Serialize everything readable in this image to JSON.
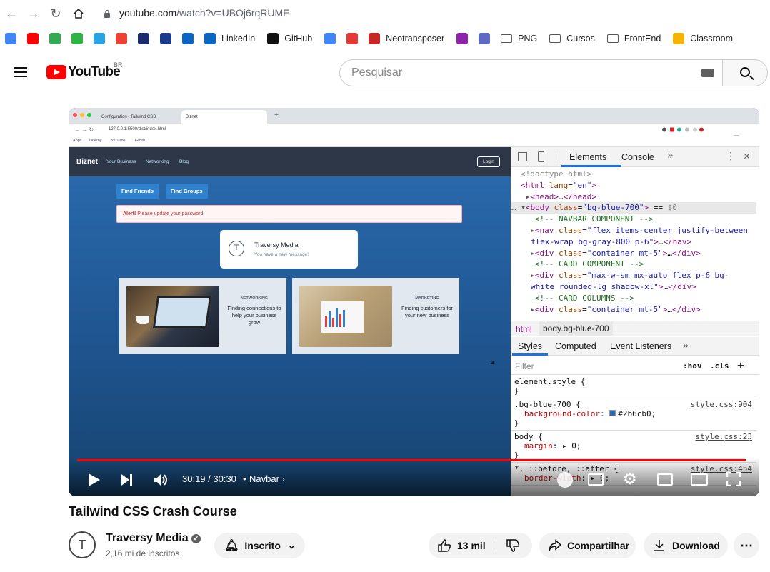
{
  "browser": {
    "address_host": "youtube.com",
    "address_path": "/watch?v=UBOj6rqRUME",
    "bookmarks": [
      {
        "label": "",
        "color": "#4285f4",
        "icon": "google-icon"
      },
      {
        "label": "",
        "color": "#ff0000",
        "icon": "youtube-icon"
      },
      {
        "label": "",
        "color": "#34a853",
        "icon": "drive-icon"
      },
      {
        "label": "",
        "color": "#2fb344",
        "icon": "whatsapp-icon"
      },
      {
        "label": "",
        "color": "#2aa3e0",
        "icon": "telegram-icon"
      },
      {
        "label": "",
        "color": "#ea4335",
        "icon": "gmail-icon"
      },
      {
        "label": "",
        "color": "#1c2b6b",
        "icon": "app-icon"
      },
      {
        "label": "",
        "color": "#1b3a8a",
        "icon": "app-icon-2"
      },
      {
        "label": "",
        "color": "#0a66c2",
        "icon": "outlook-icon"
      },
      {
        "label": "LinkedIn",
        "color": "#0a66c2",
        "icon": "linkedin-icon"
      },
      {
        "label": "GitHub",
        "color": "#111111",
        "icon": "github-icon"
      },
      {
        "label": "",
        "color": "#4285f4",
        "icon": "translate-icon"
      },
      {
        "label": "",
        "color": "#e53935",
        "icon": "download-icon"
      },
      {
        "label": "Neotransposer",
        "color": "#c62828",
        "icon": "re-icon"
      },
      {
        "label": "",
        "color": "#8e24aa",
        "icon": "app-icon-3"
      },
      {
        "label": "",
        "color": "#5c6bc0",
        "icon": "app-icon-4"
      },
      {
        "label": "PNG",
        "color": "#555555",
        "icon": "folder-icon"
      },
      {
        "label": "Cursos",
        "color": "#555555",
        "icon": "folder-icon"
      },
      {
        "label": "FrontEnd",
        "color": "#555555",
        "icon": "folder-icon"
      },
      {
        "label": "Classroom",
        "color": "#f4b400",
        "icon": "classroom-icon"
      }
    ]
  },
  "header": {
    "logo_text": "YouTube",
    "region": "BR",
    "search_placeholder": "Pesquisar"
  },
  "video_frame": {
    "tabs": [
      "Configuration - Tailwind CSS",
      "Biznet"
    ],
    "address": "127.0.0.1:5500/dist/index.html",
    "bookmarks": [
      "Apps",
      "Udemy",
      "YouTube",
      "Gmail"
    ],
    "site": {
      "brand": "Biznet",
      "nav": [
        "Your Business",
        "Networking",
        "Blog"
      ],
      "login": "Login",
      "buttons": [
        "Find Friends",
        "Find Groups"
      ],
      "alert_strong": "Alert!",
      "alert_text": " Please update your password",
      "toast_title": "Traversy Media",
      "toast_text": "You have a new message!",
      "cards": [
        {
          "tag": "NETWORKING",
          "text": "Finding connections to help your business grow"
        },
        {
          "tag": "MARKETING",
          "text": "Finding customers for your new business"
        }
      ]
    },
    "devtools": {
      "tabs": [
        "Elements",
        "Console"
      ],
      "code": [
        {
          "html": "<span style='color:#888'>&lt;!doctype html&gt;</span>"
        },
        {
          "html": "<span style='color:#881280'>&lt;html</span> <span style='color:#994500'>lang</span>=<span style='color:#1a1aa6'>\"en\"</span><span style='color:#881280'>&gt;</span>"
        },
        {
          "html": "&nbsp;<span style='color:#555'>▸</span><span style='color:#881280'>&lt;head&gt;</span>…<span style='color:#881280'>&lt;/head&gt;</span>"
        },
        {
          "html": "<span style='color:#555'>… ▾</span><span style='color:#881280'>&lt;body</span> <span style='color:#994500'>class</span>=<span style='color:#1a1aa6'>\"bg-blue-700\"</span><span style='color:#881280'>&gt;</span> == <span style='color:#888'>$0</span>",
          "sel": true
        },
        {
          "html": "&nbsp;&nbsp;&nbsp;<span style='color:#236e25'>&lt;!-- NAVBAR COMPONENT --&gt;</span>"
        },
        {
          "html": "&nbsp;&nbsp;<span style='color:#555'>▸</span><span style='color:#881280'>&lt;nav</span> <span style='color:#994500'>class</span>=<span style='color:#1a1aa6'>\"flex items-center justify-between</span>"
        },
        {
          "html": "<span style='color:#1a1aa6'>flex-wrap bg-gray-800 p-6\"</span><span style='color:#881280'>&gt;</span>…<span style='color:#881280'>&lt;/nav&gt;</span>"
        },
        {
          "html": "&nbsp;&nbsp;<span style='color:#555'>▸</span><span style='color:#881280'>&lt;div</span> <span style='color:#994500'>class</span>=<span style='color:#1a1aa6'>\"container mt-5\"</span><span style='color:#881280'>&gt;</span>…<span style='color:#881280'>&lt;/div&gt;</span>"
        },
        {
          "html": "&nbsp;&nbsp;&nbsp;<span style='color:#236e25'>&lt;!-- CARD COMPONENT --&gt;</span>"
        },
        {
          "html": "&nbsp;&nbsp;<span style='color:#555'>▸</span><span style='color:#881280'>&lt;div</span> <span style='color:#994500'>class</span>=<span style='color:#1a1aa6'>\"max-w-sm mx-auto flex p-6 bg-</span>"
        },
        {
          "html": "<span style='color:#1a1aa6'>white rounded-lg shadow-xl\"</span><span style='color:#881280'>&gt;</span>…<span style='color:#881280'>&lt;/div&gt;</span>"
        },
        {
          "html": "&nbsp;&nbsp;&nbsp;<span style='color:#236e25'>&lt;!-- CARD COLUMNS --&gt;</span>"
        },
        {
          "html": "&nbsp;&nbsp;<span style='color:#555'>▸</span><span style='color:#881280'>&lt;div</span> <span style='color:#994500'>class</span>=<span style='color:#1a1aa6'>\"container mt-5\"</span><span style='color:#881280'>&gt;</span>…<span style='color:#881280'>&lt;/div&gt;</span>"
        }
      ],
      "crumbs": [
        "html",
        "body.bg-blue-700"
      ],
      "style_tabs": [
        "Styles",
        "Computed",
        "Event Listeners"
      ],
      "filter_placeholder": "Filter",
      "hov": ":hov",
      "cls": ".cls",
      "rules": [
        {
          "sel": "element.style {",
          "src": "",
          "props": []
        },
        {
          "sel": ".bg-blue-700 {",
          "src": "style.css:904",
          "props": [
            {
              "name": "background-color",
              "value": "#2b6cb0",
              "swatch": true
            }
          ]
        },
        {
          "sel": "body {",
          "src": "style.css:23",
          "props": [
            {
              "name": "margin",
              "value": "▸ 0",
              "swatch": false
            }
          ]
        },
        {
          "sel": "*, ::before, ::after {",
          "src": "style.css:454",
          "props": [
            {
              "name": "border-width",
              "value": "▸ 0",
              "swatch": false
            }
          ]
        }
      ]
    }
  },
  "player": {
    "time": "30:19 / 30:30",
    "chapter": "Navbar",
    "progress": 0.994
  },
  "video": {
    "title": "Tailwind CSS Crash Course",
    "channel": "Traversy Media",
    "subscribers": "2,16 mi de inscritos",
    "subscribe_label": "Inscrito",
    "likes": "13 mil",
    "share": "Compartilhar",
    "download": "Download"
  }
}
